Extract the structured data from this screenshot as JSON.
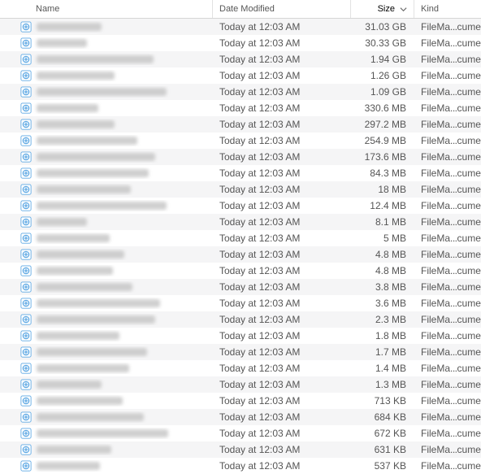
{
  "columns": {
    "name": "Name",
    "date": "Date Modified",
    "size": "Size",
    "kind": "Kind"
  },
  "kind_prefix": "FileMa",
  "kind_suffix": "cument",
  "rows": [
    {
      "nameWidth": 80,
      "date": "Today at 12:03 AM",
      "size": "31.03 GB"
    },
    {
      "nameWidth": 62,
      "date": "Today at 12:03 AM",
      "size": "30.33 GB"
    },
    {
      "nameWidth": 144,
      "date": "Today at 12:03 AM",
      "size": "1.94 GB"
    },
    {
      "nameWidth": 96,
      "date": "Today at 12:03 AM",
      "size": "1.26 GB"
    },
    {
      "nameWidth": 160,
      "date": "Today at 12:03 AM",
      "size": "1.09 GB"
    },
    {
      "nameWidth": 76,
      "date": "Today at 12:03 AM",
      "size": "330.6 MB"
    },
    {
      "nameWidth": 96,
      "date": "Today at 12:03 AM",
      "size": "297.2 MB"
    },
    {
      "nameWidth": 124,
      "date": "Today at 12:03 AM",
      "size": "254.9 MB"
    },
    {
      "nameWidth": 146,
      "date": "Today at 12:03 AM",
      "size": "173.6 MB"
    },
    {
      "nameWidth": 138,
      "date": "Today at 12:03 AM",
      "size": "84.3 MB"
    },
    {
      "nameWidth": 116,
      "date": "Today at 12:03 AM",
      "size": "18 MB"
    },
    {
      "nameWidth": 160,
      "date": "Today at 12:03 AM",
      "size": "12.4 MB"
    },
    {
      "nameWidth": 62,
      "date": "Today at 12:03 AM",
      "size": "8.1 MB"
    },
    {
      "nameWidth": 90,
      "date": "Today at 12:03 AM",
      "size": "5 MB"
    },
    {
      "nameWidth": 108,
      "date": "Today at 12:03 AM",
      "size": "4.8 MB"
    },
    {
      "nameWidth": 94,
      "date": "Today at 12:03 AM",
      "size": "4.8 MB"
    },
    {
      "nameWidth": 118,
      "date": "Today at 12:03 AM",
      "size": "3.8 MB"
    },
    {
      "nameWidth": 152,
      "date": "Today at 12:03 AM",
      "size": "3.6 MB"
    },
    {
      "nameWidth": 146,
      "date": "Today at 12:03 AM",
      "size": "2.3 MB"
    },
    {
      "nameWidth": 102,
      "date": "Today at 12:03 AM",
      "size": "1.8 MB"
    },
    {
      "nameWidth": 136,
      "date": "Today at 12:03 AM",
      "size": "1.7 MB"
    },
    {
      "nameWidth": 114,
      "date": "Today at 12:03 AM",
      "size": "1.4 MB"
    },
    {
      "nameWidth": 80,
      "date": "Today at 12:03 AM",
      "size": "1.3 MB"
    },
    {
      "nameWidth": 106,
      "date": "Today at 12:03 AM",
      "size": "713 KB"
    },
    {
      "nameWidth": 132,
      "date": "Today at 12:03 AM",
      "size": "684 KB"
    },
    {
      "nameWidth": 162,
      "date": "Today at 12:03 AM",
      "size": "672 KB"
    },
    {
      "nameWidth": 92,
      "date": "Today at 12:03 AM",
      "size": "631 KB"
    },
    {
      "nameWidth": 78,
      "date": "Today at 12:03 AM",
      "size": "537 KB"
    }
  ]
}
